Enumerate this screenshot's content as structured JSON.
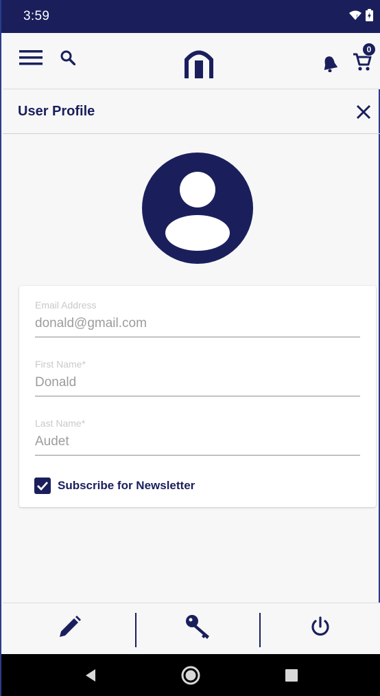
{
  "status_bar": {
    "time": "3:59",
    "icons": [
      "wifi-icon",
      "battery-icon"
    ]
  },
  "app_bar": {
    "icons": [
      "menu-icon",
      "search-icon",
      "home-logo-icon",
      "notification-bell-icon",
      "cart-icon"
    ],
    "cart_count": "0"
  },
  "page": {
    "title": "User Profile",
    "close_icon": "close-icon"
  },
  "avatar": {
    "icon": "user-avatar-icon"
  },
  "form": {
    "email": {
      "label": "Email Address",
      "value": "donald@gmail.com"
    },
    "first_name": {
      "label": "First Name*",
      "value": "Donald"
    },
    "last_name": {
      "label": "Last Name*",
      "value": "Audet"
    },
    "newsletter": {
      "label": "Subscribe for Newsletter",
      "checked": true
    }
  },
  "actions": {
    "icons": [
      "edit-pencil-icon",
      "key-icon",
      "power-icon"
    ]
  },
  "nav_bar": {
    "icons": [
      "back-icon",
      "home-icon",
      "recents-icon"
    ]
  },
  "colors": {
    "primary": "#1a1f5c",
    "background": "#f7f7f7",
    "card": "#ffffff",
    "field_text": "#9c9c9c",
    "field_label": "#c9c9c9"
  }
}
